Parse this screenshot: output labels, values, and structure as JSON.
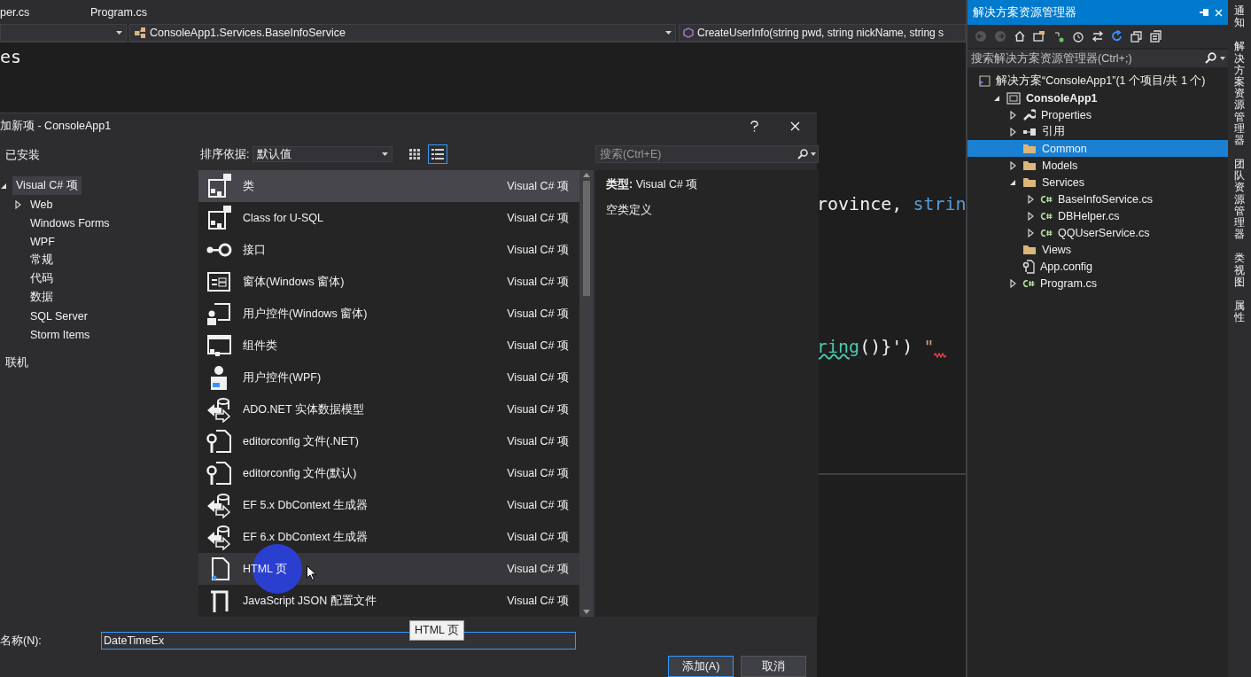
{
  "editor": {
    "tabs": [
      {
        "label": "per.cs",
        "selected": false
      },
      {
        "label": "Program.cs",
        "selected": false
      }
    ],
    "type_dropdown": "ConsoleApp1.Services.BaseInfoService",
    "member_dropdown": "CreateUserInfo(string pwd, string nickName, string s",
    "code_lines": [
      {
        "tokens": [
          {
            "text": "es",
            "kind": "plain"
          }
        ]
      },
      {
        "tokens": [
          {
            "text": "rovince, ",
            "kind": "plain"
          },
          {
            "text": "strin",
            "kind": "keyword"
          }
        ]
      },
      {
        "tokens": [
          {
            "text": "ring",
            "kind": "warning"
          },
          {
            "text": "()}') ",
            "kind": "plain"
          },
          {
            "text": "\"",
            "kind": "error"
          }
        ]
      }
    ]
  },
  "dialog": {
    "title": "加新项 - ConsoleApp1",
    "installed_heading": "已安装",
    "categories": [
      {
        "label": "Visual C# 项",
        "selected": true,
        "expanded": true,
        "children": [
          {
            "label": "Web",
            "selected": false,
            "expanded": false
          },
          {
            "label": "Windows Forms",
            "selected": false
          },
          {
            "label": "WPF",
            "selected": false
          },
          {
            "label": "常规",
            "selected": false
          },
          {
            "label": "代码",
            "selected": false
          },
          {
            "label": "数据",
            "selected": false
          },
          {
            "label": "SQL Server",
            "selected": false
          },
          {
            "label": "Storm Items",
            "selected": false
          }
        ]
      }
    ],
    "online_heading": "联机",
    "sort_label": "排序依据:",
    "sort_value": "默认值",
    "views": [
      {
        "kind": "grid",
        "selected": false
      },
      {
        "kind": "list",
        "selected": true
      }
    ],
    "search_placeholder": "搜索(Ctrl+E)",
    "templates": [
      {
        "name": "类",
        "type": "Visual C# 项",
        "kind": "class",
        "selected": true,
        "hovered": false
      },
      {
        "name": "Class for U-SQL",
        "type": "Visual C# 项",
        "kind": "class",
        "selected": false,
        "hovered": false
      },
      {
        "name": "接口",
        "type": "Visual C# 项",
        "kind": "interface",
        "selected": false,
        "hovered": false
      },
      {
        "name": "窗体(Windows 窗体)",
        "type": "Visual C# 项",
        "kind": "form",
        "selected": false,
        "hovered": false
      },
      {
        "name": "用户控件(Windows 窗体)",
        "type": "Visual C# 项",
        "kind": "usercontrol",
        "selected": false,
        "hovered": false
      },
      {
        "name": "组件类",
        "type": "Visual C# 项",
        "kind": "component",
        "selected": false,
        "hovered": false
      },
      {
        "name": "用户控件(WPF)",
        "type": "Visual C# 项",
        "kind": "wpf",
        "selected": false,
        "hovered": false
      },
      {
        "name": "ADO.NET 实体数据模型",
        "type": "Visual C# 项",
        "kind": "data",
        "selected": false,
        "hovered": false
      },
      {
        "name": "editorconfig 文件(.NET)",
        "type": "Visual C# 项",
        "kind": "config",
        "selected": false,
        "hovered": false
      },
      {
        "name": "editorconfig 文件(默认)",
        "type": "Visual C# 项",
        "kind": "config",
        "selected": false,
        "hovered": false
      },
      {
        "name": "EF 5.x DbContext 生成器",
        "type": "Visual C# 项",
        "kind": "data",
        "selected": false,
        "hovered": false
      },
      {
        "name": "EF 6.x DbContext 生成器",
        "type": "Visual C# 项",
        "kind": "data",
        "selected": false,
        "hovered": false
      },
      {
        "name": "HTML 页",
        "type": "Visual C# 项",
        "kind": "html",
        "selected": false,
        "hovered": true
      },
      {
        "name": "JavaScript JSON 配置文件",
        "type": "Visual C# 项",
        "kind": "script",
        "selected": false,
        "hovered": false
      }
    ],
    "details": {
      "type_line": "**类型:** Visual C# 项",
      "description": "空类定义"
    },
    "name_label": "名称(N):",
    "name_value": "DateTimeEx",
    "tooltip": "HTML 页",
    "buttons": [
      {
        "label": "添加(A)",
        "kind": "primary"
      },
      {
        "label": "取消",
        "kind": "normal"
      }
    ]
  },
  "solution_explorer": {
    "title": "解决方案资源管理器",
    "search_placeholder": "搜索解决方案资源管理器(Ctrl+;)",
    "tree": [
      {
        "label": "解决方案“ConsoleApp1”(1 个项目/共 1 个)",
        "kind": "solution",
        "selected": false,
        "children": [
          {
            "label": "ConsoleApp1",
            "kind": "project",
            "expanded": true,
            "selected": false,
            "children": [
              {
                "label": "Properties",
                "kind": "properties",
                "expanded": false,
                "selected": false
              },
              {
                "label": "引用",
                "kind": "references",
                "expanded": false,
                "selected": false
              },
              {
                "label": "Common",
                "kind": "folder",
                "selected": true
              },
              {
                "label": "Models",
                "kind": "folder",
                "expanded": false,
                "selected": false
              },
              {
                "label": "Services",
                "kind": "folder",
                "expanded": true,
                "selected": false,
                "children": [
                  {
                    "label": "BaseInfoService.cs",
                    "kind": "csharp",
                    "expanded": false,
                    "selected": false
                  },
                  {
                    "label": "DBHelper.cs",
                    "kind": "csharp",
                    "expanded": false,
                    "selected": false
                  },
                  {
                    "label": "QQUserService.cs",
                    "kind": "csharp",
                    "expanded": false,
                    "selected": false
                  }
                ]
              },
              {
                "label": "Views",
                "kind": "folder",
                "selected": false
              },
              {
                "label": "App.config",
                "kind": "config",
                "selected": false
              },
              {
                "label": "Program.cs",
                "kind": "csharp",
                "expanded": false,
                "selected": false
              }
            ]
          }
        ]
      }
    ]
  },
  "side_tabs": [
    {
      "label": "通知"
    },
    {
      "label": "解决方案资源管理器"
    },
    {
      "label": "团队资源管理器"
    },
    {
      "label": "类视图"
    },
    {
      "label": "属性"
    }
  ]
}
